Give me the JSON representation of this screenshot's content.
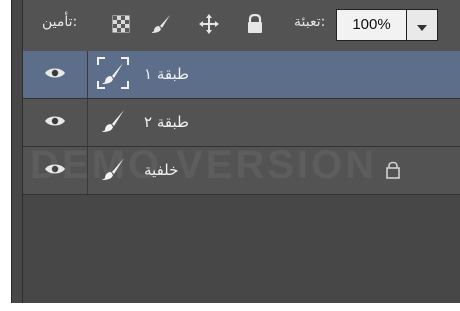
{
  "lockbar": {
    "lock_label": ":تأمين",
    "lock_icons": [
      "transparency-lock-icon",
      "brush-lock-icon",
      "move-lock-icon",
      "lock-all-icon"
    ],
    "fill_label": ":تعبئة",
    "fill_value": "100%",
    "fill_dropdown_icon": "chevron-down-icon"
  },
  "layers": [
    {
      "name": "طبقة ١",
      "selected": true,
      "locked": false,
      "icon": "brush-icon"
    },
    {
      "name": "طبقة ٢",
      "selected": false,
      "locked": false,
      "icon": "brush-icon"
    },
    {
      "name": "خلفية",
      "selected": false,
      "locked": true,
      "icon": "brush-icon"
    }
  ],
  "watermark": "DEMO VERSION",
  "colors": {
    "panel": "#535353",
    "background": "#474747",
    "selected": "#5d6e8a"
  }
}
